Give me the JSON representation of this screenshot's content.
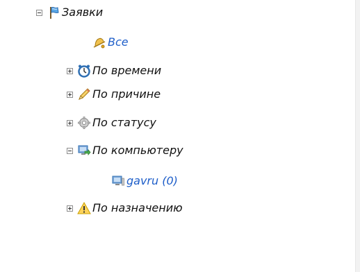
{
  "tree": {
    "root": {
      "label": "Заявки",
      "expanded": true,
      "icon": "flag-icon"
    },
    "items": [
      {
        "label": "Все",
        "icon": "bell-icon",
        "toggle": "none",
        "highlight": true
      },
      {
        "label": "По времени",
        "icon": "clock-icon",
        "toggle": "plus"
      },
      {
        "label": "По причине",
        "icon": "pencil-icon",
        "toggle": "plus"
      },
      {
        "label": "По статусу",
        "icon": "gear-icon",
        "toggle": "plus"
      },
      {
        "label": "По компьютеру",
        "icon": "computer-icon",
        "toggle": "minus",
        "children": [
          {
            "label": "gavru (0)",
            "icon": "computer-icon",
            "highlight": true
          }
        ]
      },
      {
        "label": "По назначению",
        "icon": "warning-icon",
        "toggle": "plus"
      }
    ]
  },
  "colors": {
    "link": "#1e5ec9",
    "text": "#111111",
    "background": "#ffffff"
  }
}
